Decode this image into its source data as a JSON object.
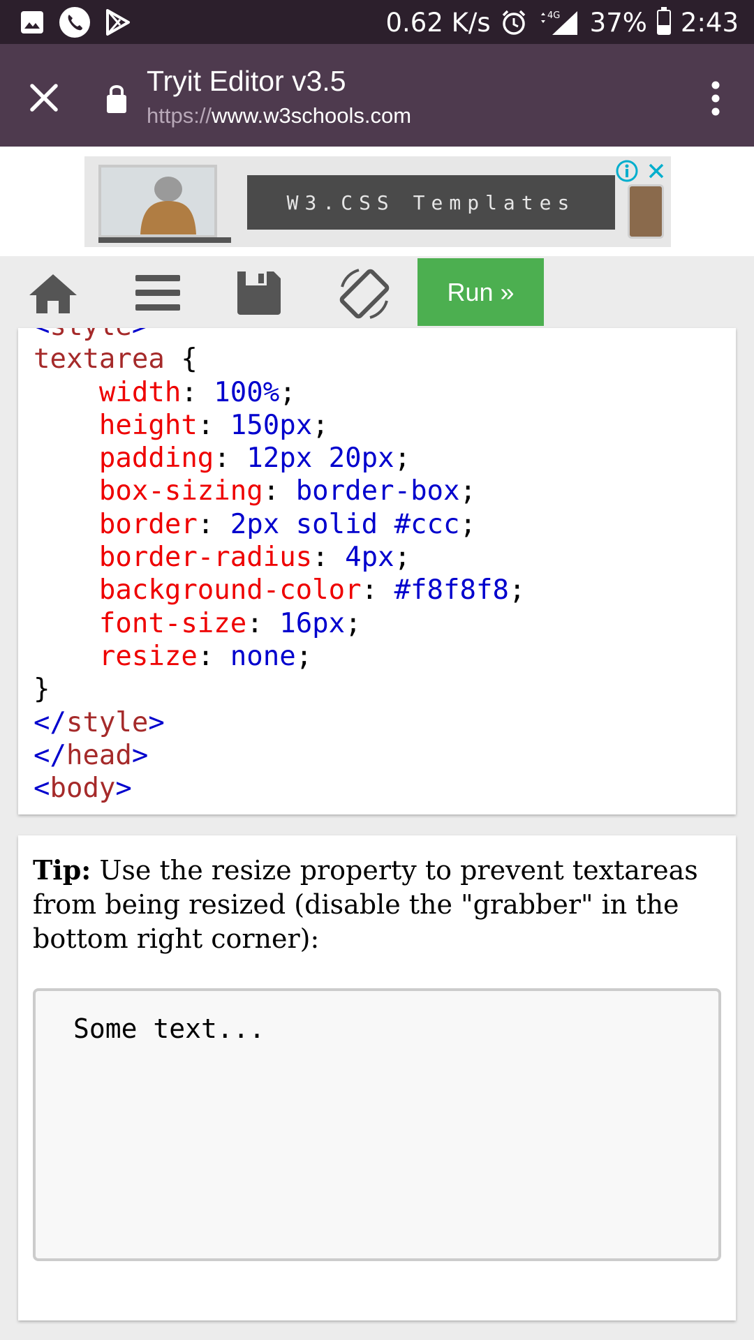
{
  "status_bar": {
    "net_speed": "0.62 K/s",
    "network": "4G",
    "battery": "37%",
    "battery_level": 0.37,
    "time": "2:43"
  },
  "browser": {
    "title": "Tryit Editor v3.5",
    "url_scheme": "https://",
    "url_host": "www.w3schools.com"
  },
  "ad": {
    "banner_text": "W3.CSS Templates"
  },
  "toolbar": {
    "run_label": "Run »",
    "icons": [
      "home-icon",
      "menu-icon",
      "save-icon",
      "rotate-icon"
    ],
    "run_color": "#4caf50"
  },
  "code": {
    "lines": [
      {
        "tag": "<style>"
      },
      {
        "selector": "textarea",
        "brace": " {"
      },
      {
        "prop": "width",
        "value": "100%"
      },
      {
        "prop": "height",
        "value": "150px"
      },
      {
        "prop": "padding",
        "value": "12px 20px"
      },
      {
        "prop": "box-sizing",
        "value": "border-box"
      },
      {
        "prop": "border",
        "value": "2px solid #ccc"
      },
      {
        "prop": "border-radius",
        "value": "4px"
      },
      {
        "prop": "background-color",
        "value": "#f8f8f8"
      },
      {
        "prop": "font-size",
        "value": "16px"
      },
      {
        "prop": "resize",
        "value": "none"
      },
      {
        "close": "}"
      },
      {
        "ctag": "style"
      },
      {
        "ctag": "head"
      },
      {
        "otag": "body"
      }
    ]
  },
  "result": {
    "tip_label": "Tip:",
    "tip_text": " Use the resize property to prevent textareas from being resized (disable the \"grabber\" in the bottom right corner):",
    "textarea_value": "Some text..."
  }
}
